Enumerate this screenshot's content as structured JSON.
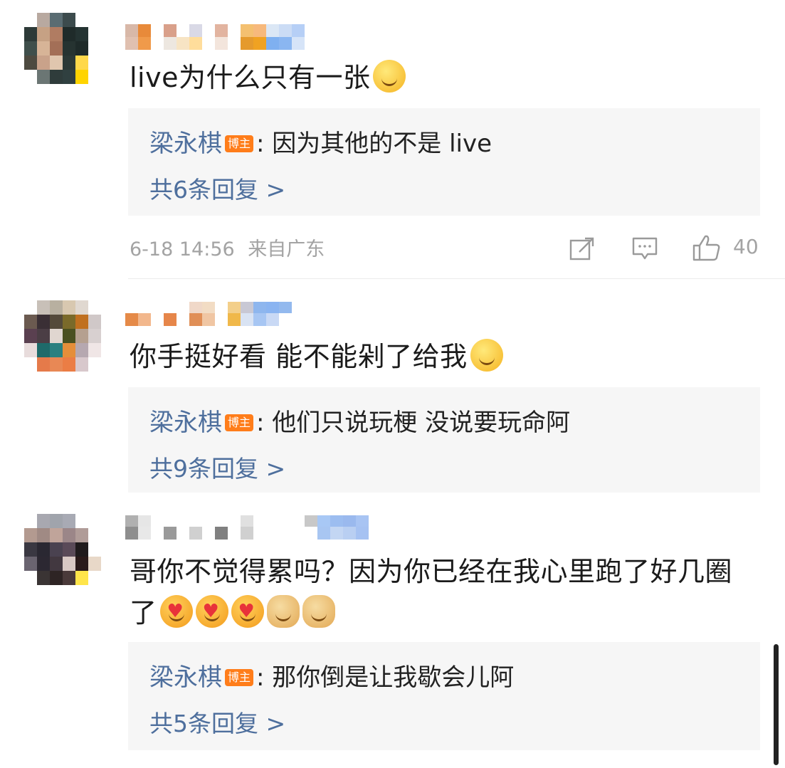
{
  "comments": [
    {
      "text": "live为什么只有一张",
      "emojis": [
        "smile"
      ],
      "reply": {
        "author": "梁永棋",
        "badge": "博主",
        "separator": ":",
        "text": "因为其他的不是 live",
        "count_label": "共6条回复 >"
      },
      "meta": {
        "time": "6-18 14:56",
        "location": "来自广东"
      },
      "likes": "40"
    },
    {
      "text": "你手挺好看 能不能剁了给我",
      "emojis": [
        "grin"
      ],
      "reply": {
        "author": "梁永棋",
        "badge": "博主",
        "separator": ":",
        "text": "他们只说玩梗 没说要玩命阿",
        "count_label": "共9条回复 >"
      }
    },
    {
      "text": "哥你不觉得累吗？因为你已经在我心里跑了好几圈了",
      "emojis": [
        "hug",
        "hug",
        "hug",
        "doge",
        "doge"
      ],
      "reply": {
        "author": "梁永棋",
        "badge": "博主",
        "separator": ":",
        "text": "那你倒是让我歇会儿阿",
        "count_label": "共5条回复 >"
      }
    }
  ],
  "icons": {
    "share": "share-icon",
    "comment": "comment-icon",
    "like": "thumbs-up-icon"
  },
  "colors": {
    "link": "#4e6f9d",
    "badge": "#ff7d1a",
    "reply_bg": "#f6f6f6",
    "meta": "#a3a3a3"
  }
}
